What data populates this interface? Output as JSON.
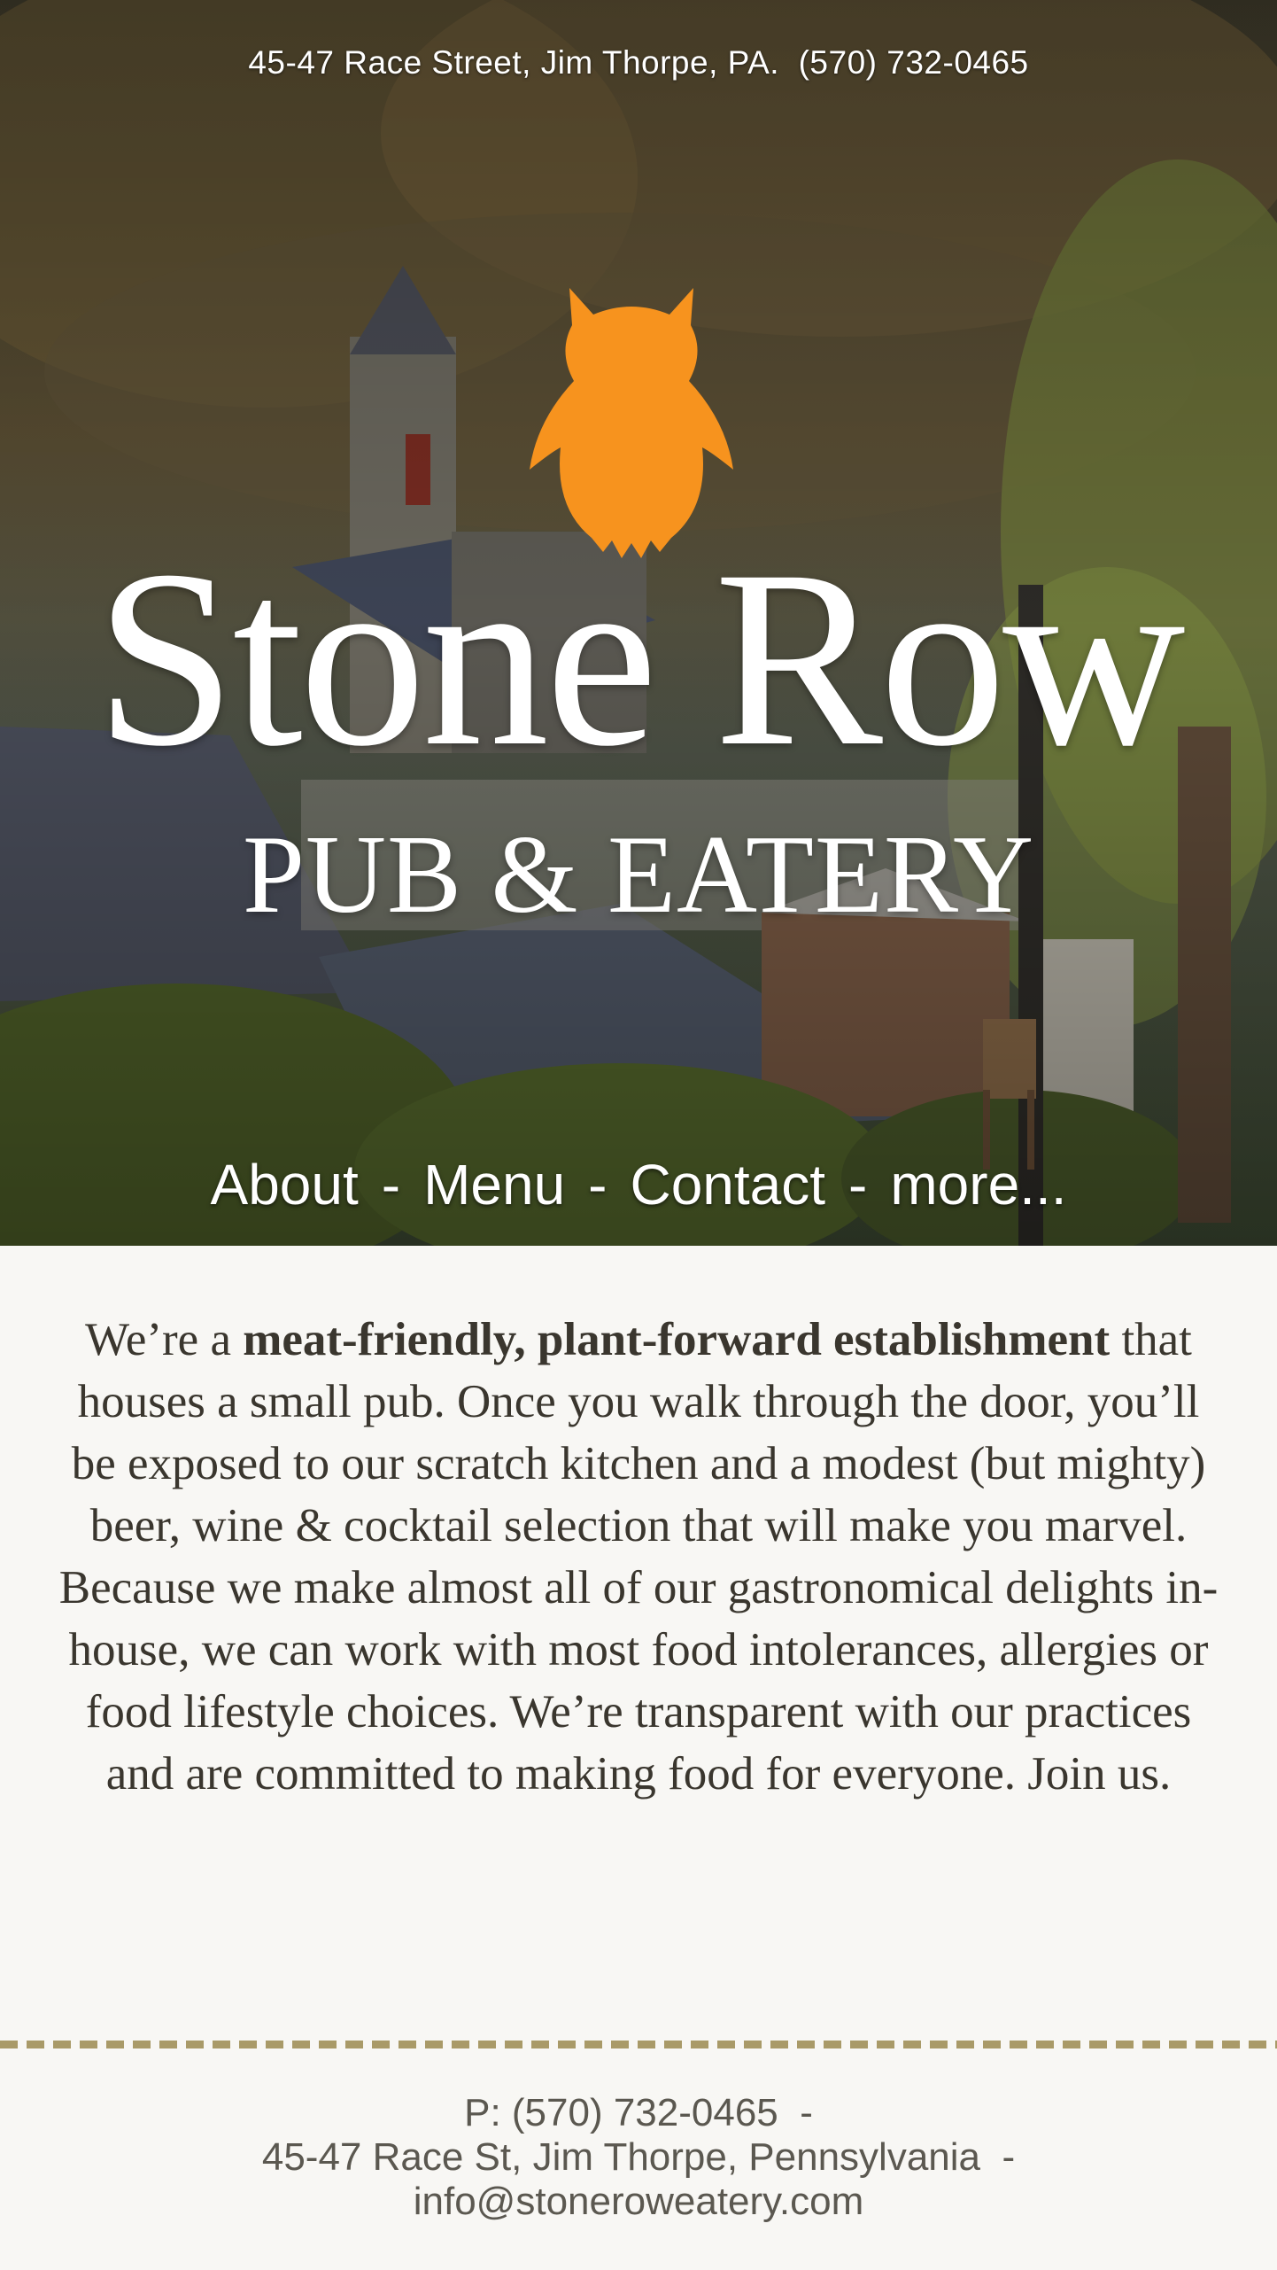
{
  "header": {
    "address": "45-47 Race Street, Jim Thorpe, PA.",
    "phone": "(570) 732-0465"
  },
  "brand": {
    "title": "Stone Row",
    "subtitle": "PUB & EATERY",
    "logo_icon": "owl-icon",
    "logo_color": "#f7931e"
  },
  "nav": {
    "items": [
      {
        "label": "About"
      },
      {
        "label": "Menu"
      },
      {
        "label": "Contact"
      },
      {
        "label": "more..."
      }
    ],
    "separator": "-"
  },
  "intro": {
    "lead": "We’re a ",
    "bold": "meat-friendly, plant-forward establishment",
    "rest": " that houses a small pub. Once you walk through the door, you’ll be exposed to our scratch kitchen and a modest (but mighty) beer, wine & cocktail selection that will make you marvel. Because we make almost all of our gastronomical delights in-house, we can work with most food intolerances, allergies or food lifestyle choices. We’re transparent with our practices and are committed to making food for everyone. Join us."
  },
  "footer": {
    "phone": "P: (570) 732-0465",
    "address": "45-47 Race St, Jim Thorpe, Pennsylvania",
    "email": "info@stoneroweatery.com",
    "separator": "-"
  },
  "colors": {
    "accent": "#f7931e",
    "divider": "#a99a68",
    "page_background": "#f8f7f4",
    "body_text": "#3a362e"
  }
}
